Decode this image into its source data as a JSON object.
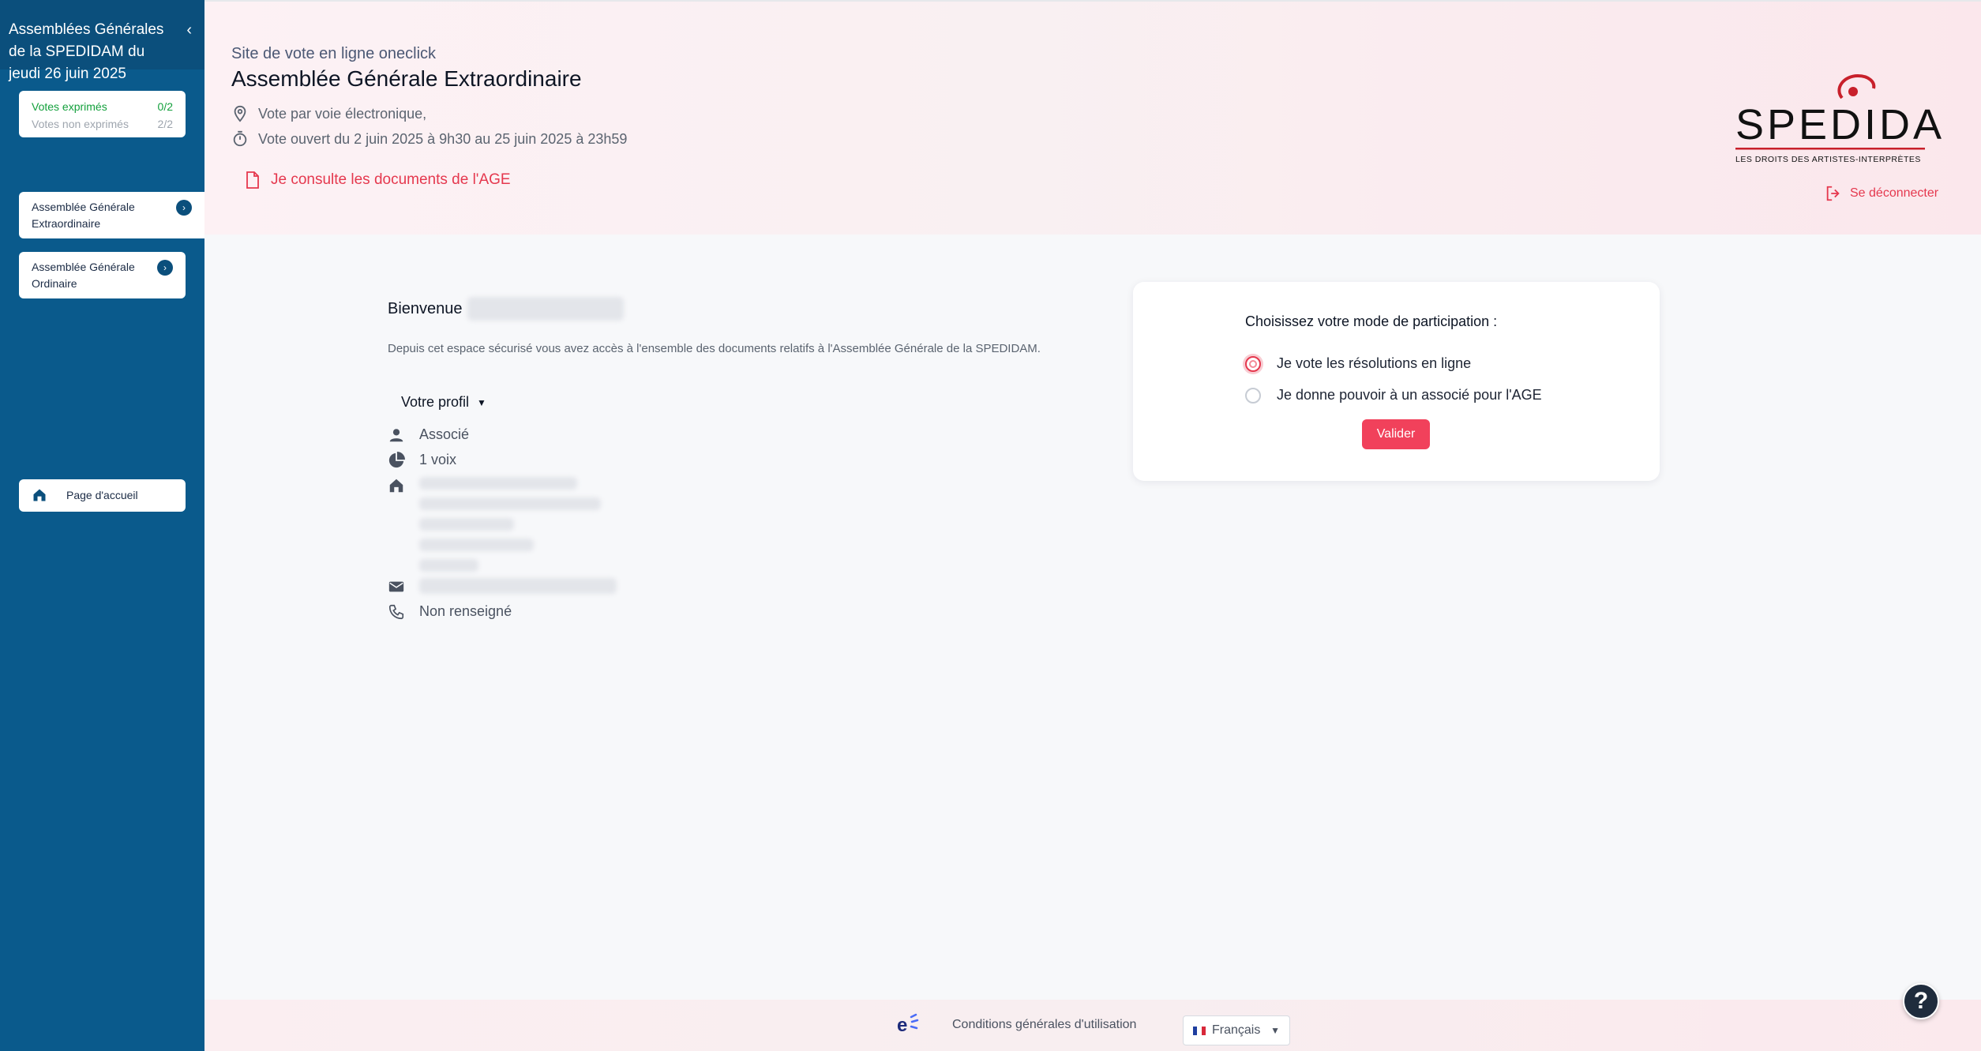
{
  "sidebar": {
    "header_title": "Assemblées Générales de la SPEDIDAM du jeudi 26 juin 2025",
    "collapse_glyph": "‹",
    "votes": {
      "cast_label": "Votes exprimés",
      "cast_count": "0/2",
      "pending_label": "Votes non exprimés",
      "pending_count": "2/2"
    },
    "items": [
      {
        "label": "Assemblée Générale Extraordinaire"
      },
      {
        "label": "Assemblée Générale Ordinaire"
      },
      {
        "label": "Page d'accueil"
      }
    ]
  },
  "header": {
    "subtitle": "Site de vote en ligne oneclick",
    "title": "Assemblée Générale Extraordinaire",
    "location": "Vote par voie électronique,",
    "schedule": "Vote ouvert du 2 juin 2025 à 9h30 au 25 juin 2025 à 23h59",
    "documents_link": "Je consulte les documents de l'AGE",
    "logout": "Se déconnecter",
    "logo": {
      "name": "SPEDIDAM",
      "tagline": "LES DROITS DES ARTISTES-INTERPRÈTES"
    }
  },
  "main": {
    "welcome": "Bienvenue",
    "intro": "Depuis cet espace sécurisé vous avez accès à l'ensemble des documents relatifs à l'Assemblée Générale de la SPEDIDAM.",
    "profile_toggle": "Votre profil",
    "profile": {
      "role": "Associé",
      "votes": "1 voix",
      "phone": "Non renseigné"
    }
  },
  "participation": {
    "title": "Choisissez votre mode de participation :",
    "options": [
      {
        "label": "Je vote les résolutions en ligne",
        "selected": true
      },
      {
        "label": "Je donne pouvoir à un associé pour l'AGE",
        "selected": false
      }
    ],
    "submit": "Valider"
  },
  "footer": {
    "cgu": "Conditions générales d'utilisation",
    "language": "Français"
  },
  "help_glyph": "?",
  "colors": {
    "sidebar": "#0a5a8c",
    "accent": "#e5384e",
    "button": "#f1415b",
    "votes_done": "#13a03c"
  }
}
